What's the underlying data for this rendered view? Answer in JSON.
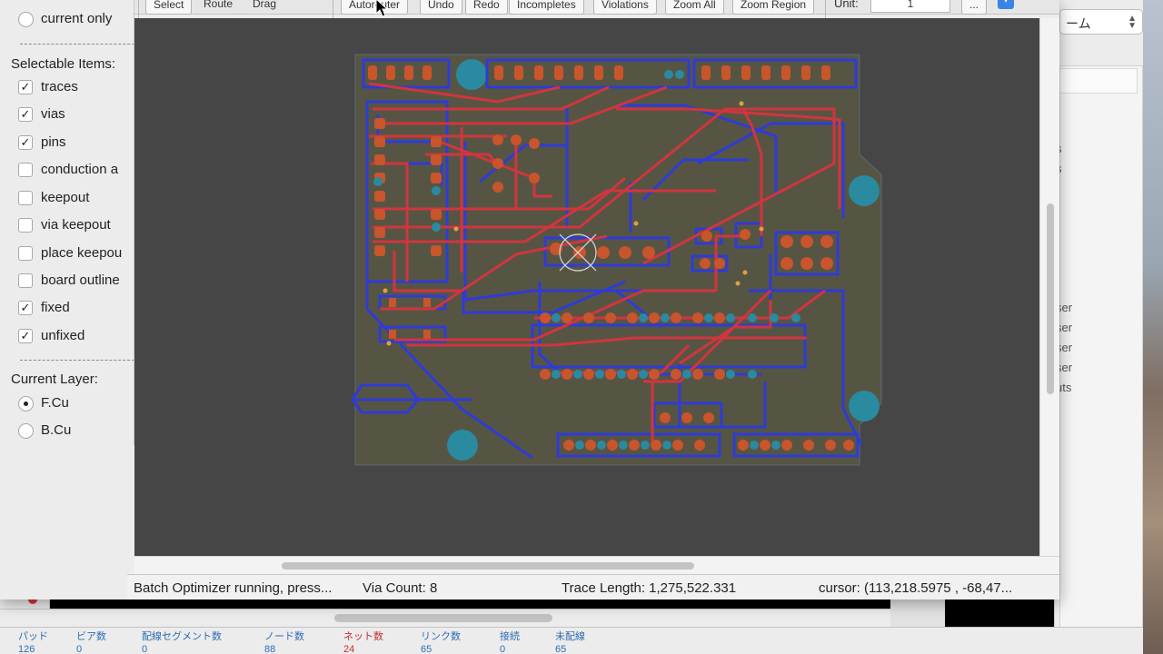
{
  "freerouting": {
    "toolbar": {
      "mode_buttons": [
        "Select",
        "Route",
        "Drag"
      ],
      "action_buttons": [
        "Autorouter",
        "Undo",
        "Redo",
        "Incompletes",
        "Violations",
        "Zoom All",
        "Zoom Region"
      ],
      "unit_label": "Unit:",
      "unit_value": "1",
      "ellipsis": "..."
    },
    "select_panel": {
      "current_only": "current only",
      "selectable_heading": "Selectable Items:",
      "items": [
        {
          "label": "traces",
          "checked": true
        },
        {
          "label": "vias",
          "checked": true
        },
        {
          "label": "pins",
          "checked": true
        },
        {
          "label": "conduction a",
          "checked": false
        },
        {
          "label": "keepout",
          "checked": false
        },
        {
          "label": "via keepout",
          "checked": false
        },
        {
          "label": "place keepou",
          "checked": false
        },
        {
          "label": "board outline",
          "checked": false
        },
        {
          "label": "fixed",
          "checked": true
        },
        {
          "label": "unfixed",
          "checked": true
        }
      ],
      "layer_heading": "Current Layer:",
      "layers": [
        {
          "label": "F.Cu",
          "selected": true
        },
        {
          "label": "B.Cu",
          "selected": false
        }
      ]
    },
    "status": {
      "message": "Batch Optimizer running, press...",
      "via_count": "Via Count: 8",
      "trace_length": "Trace Length: 1,275,522.331",
      "cursor": "cursor:  (113,218.5975 , -68,47..."
    },
    "colors": {
      "canvas_bg": "#464646",
      "board_fill": "#555544",
      "front_copper": "#d1353d",
      "back_copper": "#2f3bd6",
      "pad": "#c8552c",
      "via_pad": "#2a8aa0"
    }
  },
  "kicad": {
    "layer_select": "ーム",
    "panel_items": [
      "s",
      "s",
      "ser",
      "ser",
      "ser",
      "ser",
      "uts"
    ],
    "status_bar": [
      {
        "label": "パッド",
        "value": "126",
        "red": false
      },
      {
        "label": "ビア数",
        "value": "0",
        "red": false
      },
      {
        "label": "配線セグメント数",
        "value": "0",
        "red": false
      },
      {
        "label": "ノード数",
        "value": "88",
        "red": false
      },
      {
        "label": "ネット数",
        "value": "24",
        "red": true
      },
      {
        "label": "リンク数",
        "value": "65",
        "red": false
      },
      {
        "label": "接続",
        "value": "0",
        "red": false
      },
      {
        "label": "未配線",
        "value": "65",
        "red": false
      }
    ]
  }
}
